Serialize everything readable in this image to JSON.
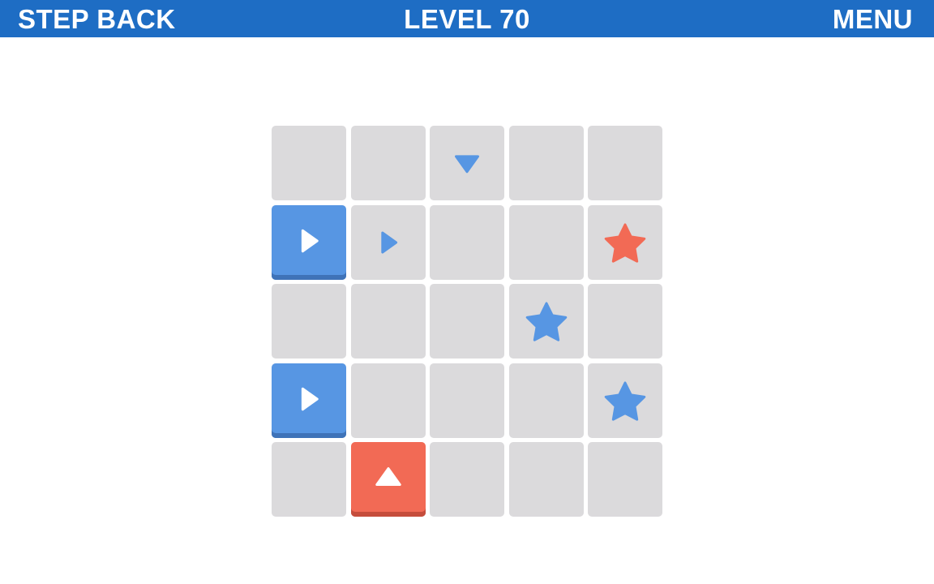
{
  "header": {
    "step_back_label": "STEP BACK",
    "level_label": "LEVEL 70",
    "menu_label": "MENU"
  },
  "colors": {
    "header_bg": "#1e6dc4",
    "cell": "#dbdadc",
    "blue": "#5796e3",
    "red": "#f26a55"
  },
  "board": {
    "rows": 5,
    "cols": 5,
    "markers": [
      {
        "row": 0,
        "col": 2,
        "kind": "arrow",
        "direction": "down",
        "color": "blue"
      },
      {
        "row": 1,
        "col": 1,
        "kind": "arrow",
        "direction": "right",
        "color": "blue"
      },
      {
        "row": 1,
        "col": 4,
        "kind": "star",
        "color": "red"
      },
      {
        "row": 2,
        "col": 3,
        "kind": "star",
        "color": "blue"
      },
      {
        "row": 3,
        "col": 4,
        "kind": "star",
        "color": "blue"
      }
    ],
    "pieces": [
      {
        "row": 1,
        "col": 0,
        "color": "blue",
        "direction": "right"
      },
      {
        "row": 3,
        "col": 0,
        "color": "blue",
        "direction": "right"
      },
      {
        "row": 4,
        "col": 1,
        "color": "red",
        "direction": "up"
      }
    ]
  }
}
